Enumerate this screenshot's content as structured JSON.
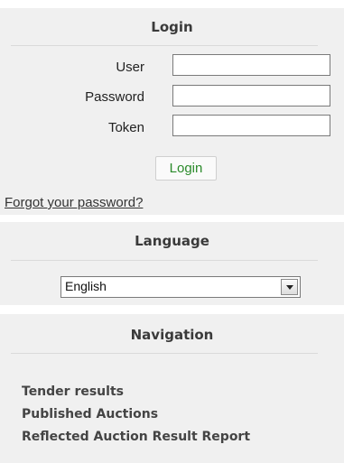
{
  "login": {
    "title": "Login",
    "fields": [
      {
        "label": "User",
        "value": ""
      },
      {
        "label": "Password",
        "value": ""
      },
      {
        "label": "Token",
        "value": ""
      }
    ],
    "button_label": "Login",
    "forgot_link": "Forgot your password?"
  },
  "language": {
    "title": "Language",
    "selected": "English"
  },
  "navigation": {
    "title": "Navigation",
    "items": [
      {
        "label": "Tender results"
      },
      {
        "label": "Published Auctions"
      },
      {
        "label": "Reflected Auction Result Report"
      }
    ]
  },
  "colors": {
    "panel_background": "#f0f0f0",
    "login_button_text": "#2a8a2a"
  }
}
